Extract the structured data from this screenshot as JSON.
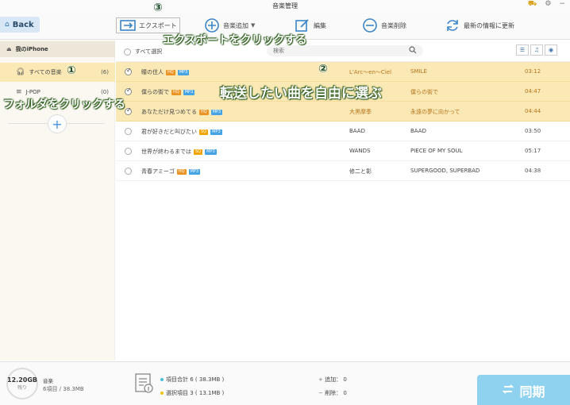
{
  "window": {
    "title": "音楽管理"
  },
  "toolbar": {
    "back_label": "Back",
    "export_label": "エクスポート",
    "add_label": "音楽追加",
    "edit_label": "編集",
    "delete_label": "音楽削除",
    "refresh_label": "最新の情報に更新"
  },
  "sidebar": {
    "device": "我のiPhone",
    "folders": [
      {
        "label": "すべての音楽",
        "count": "(6)"
      },
      {
        "label": "J-POP",
        "count": "(0)"
      }
    ]
  },
  "list": {
    "select_all_label": "すべて選択",
    "search_placeholder": "検索",
    "rows": [
      {
        "title": "瞳の住人",
        "badges": [
          "HQ",
          "MP3"
        ],
        "artist": "L'Arc～en～Ciel",
        "album": "SMILE",
        "time": "03:12",
        "selected": true
      },
      {
        "title": "僕らの街で",
        "badges": [
          "HQ",
          "MP3"
        ],
        "artist": "",
        "album": "僕らの街で",
        "time": "04:47",
        "selected": true
      },
      {
        "title": "あなただけ見つめてる",
        "badges": [
          "HQ",
          "MP3"
        ],
        "artist": "大黒摩季",
        "album": "永遠の夢に向かって",
        "time": "04:44",
        "selected": true
      },
      {
        "title": "君が好きだと叫びたい",
        "badges": [
          "SQ",
          "MP3"
        ],
        "artist": "BAAD",
        "album": "BAAD",
        "time": "03:50",
        "selected": false
      },
      {
        "title": "世界が終わるまでは",
        "badges": [
          "SQ",
          "MP3"
        ],
        "artist": "WANDS",
        "album": "PIECE OF MY SOUL",
        "time": "05:17",
        "selected": false
      },
      {
        "title": "青春アミーゴ",
        "badges": [
          "HQ",
          "MP3"
        ],
        "artist": "修二と彰",
        "album": "SUPERGOOD, SUPERBAD",
        "time": "04:38",
        "selected": false
      }
    ]
  },
  "bottom": {
    "storage_free": "12.20GB",
    "storage_free_label": "残り",
    "storage_category": "音楽",
    "storage_summary": "6項目 / 38.3MB",
    "total_items": "項目合計 6 ( 38.3MB )",
    "selected_items": "選択項目 3 ( 13.1MB )",
    "added": "追加： 0",
    "deleted": "削除： 0",
    "sync_label": "同期"
  },
  "annotations": {
    "step1": "①",
    "step2": "②",
    "step3": "③",
    "folder_hint": "フォルダをクリックする",
    "select_hint": "転送したい曲を自由に選ぶ",
    "export_hint": "エクスポートをクリックする"
  },
  "colors": {
    "selected_row": "#fbe9b5",
    "sync_button": "#8ed2ef",
    "accent_blue": "#4a90d9",
    "hq_badge": "#e99425",
    "sq_badge": "#f2a400",
    "mp3_badge": "#47a4e4"
  }
}
